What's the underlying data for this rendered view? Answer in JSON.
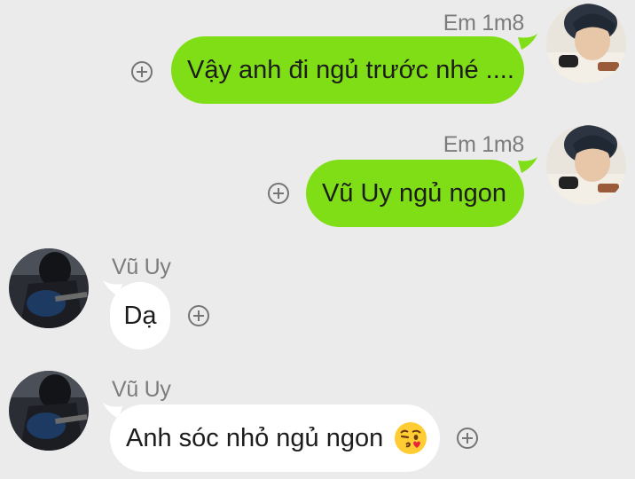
{
  "messages": [
    {
      "sender": "Em 1m8",
      "direction": "outgoing",
      "text": "Vậy anh đi ngủ trước nhé ...."
    },
    {
      "sender": "Em 1m8",
      "direction": "outgoing",
      "text": "Vũ Uy ngủ ngon"
    },
    {
      "sender": "Vũ Uy",
      "direction": "incoming",
      "text": "Dạ"
    },
    {
      "sender": "Vũ Uy",
      "direction": "incoming",
      "text": "Anh sóc nhỏ ngủ ngon",
      "emoji": "face-blowing-kiss-icon"
    }
  ],
  "icons": {
    "react": "plus-circle-icon",
    "avatar_self": "avatar-photo",
    "avatar_other": "avatar-guitar-photo"
  },
  "colors": {
    "background": "#ebebeb",
    "outgoing_bubble": "#7fde16",
    "incoming_bubble": "#ffffff",
    "sender_name": "#7c7c7c"
  }
}
